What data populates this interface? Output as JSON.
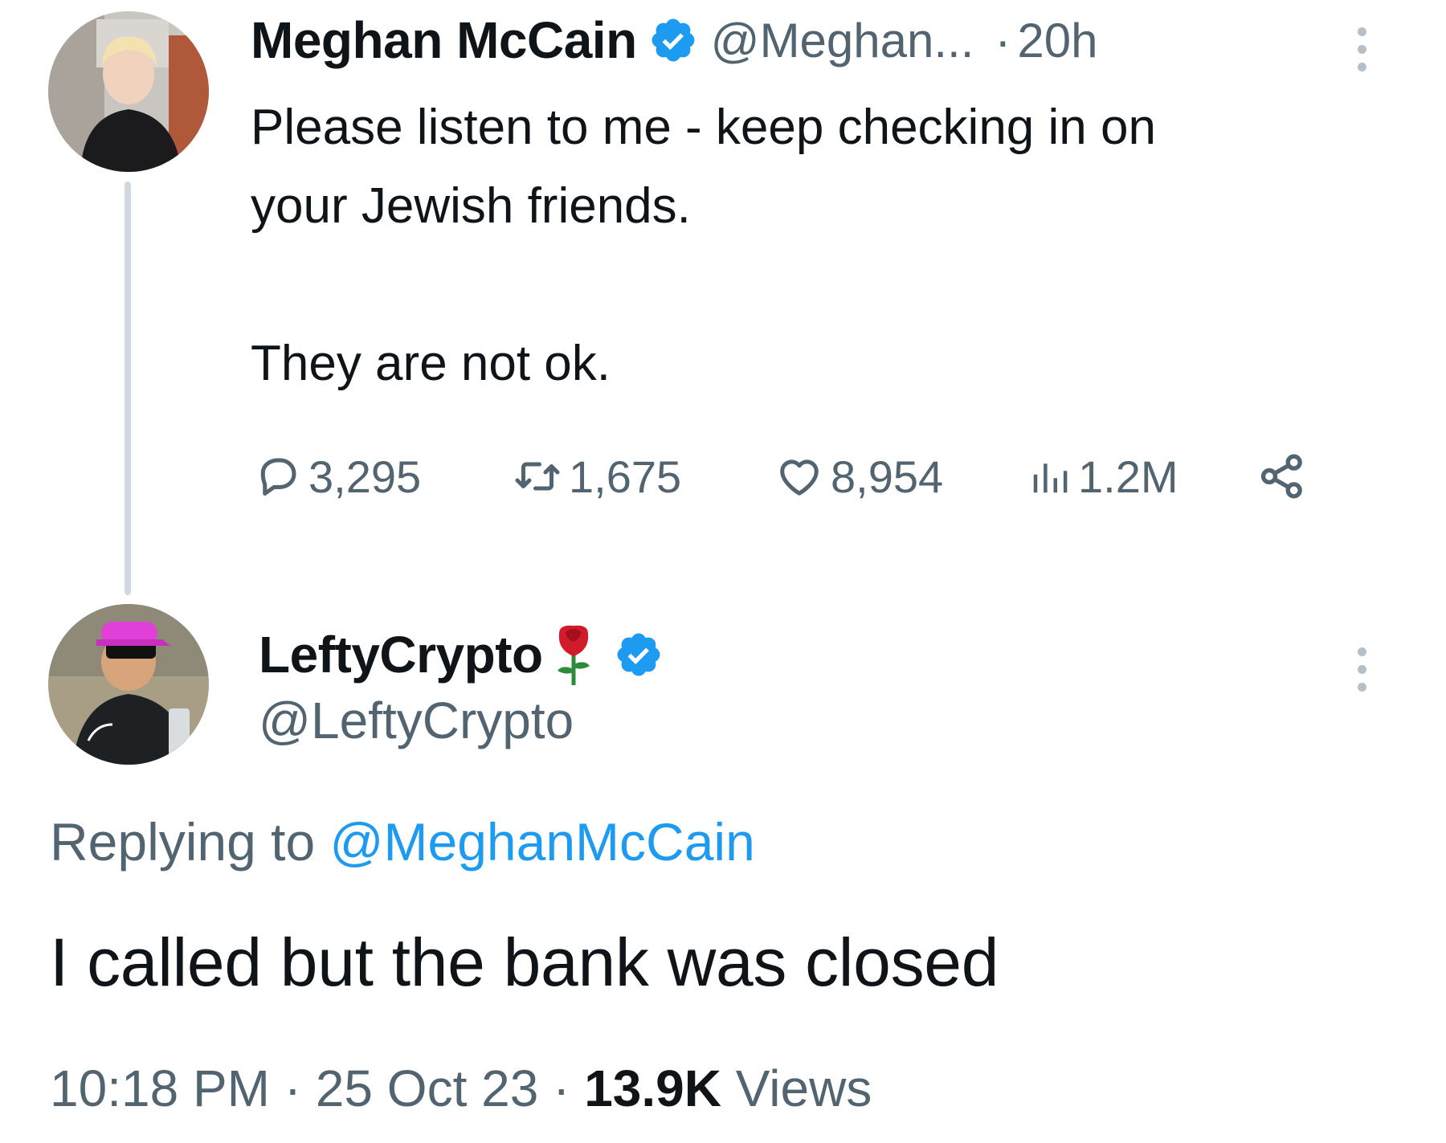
{
  "tweet": {
    "author_name": "Meghan McCain",
    "verified_icon": "verified-badge-icon",
    "handle": "@Meghan...",
    "separator": "·",
    "time": "20h",
    "text_line1": "Please listen to me - keep checking in on",
    "text_line2": "your Jewish friends.",
    "text_line3": "They are not ok.",
    "stats": {
      "replies": "3,295",
      "retweets": "1,675",
      "likes": "8,954",
      "views": "1.2M"
    }
  },
  "reply": {
    "author_name": "LeftyCrypto",
    "emoji_icon": "rose-icon",
    "handle": "@LeftyCrypto",
    "replying_prefix": "Replying to",
    "replying_mention": "@MeghanMcCain",
    "text": "I called but the bank was closed",
    "time": "10:18 PM",
    "separator": "·",
    "date": "25 Oct 23",
    "views_count": "13.9K",
    "views_label": "Views"
  },
  "colors": {
    "text": "#0f1419",
    "secondary": "#536471",
    "accent": "#1d9bf0",
    "thread_line": "#cfd9de"
  }
}
